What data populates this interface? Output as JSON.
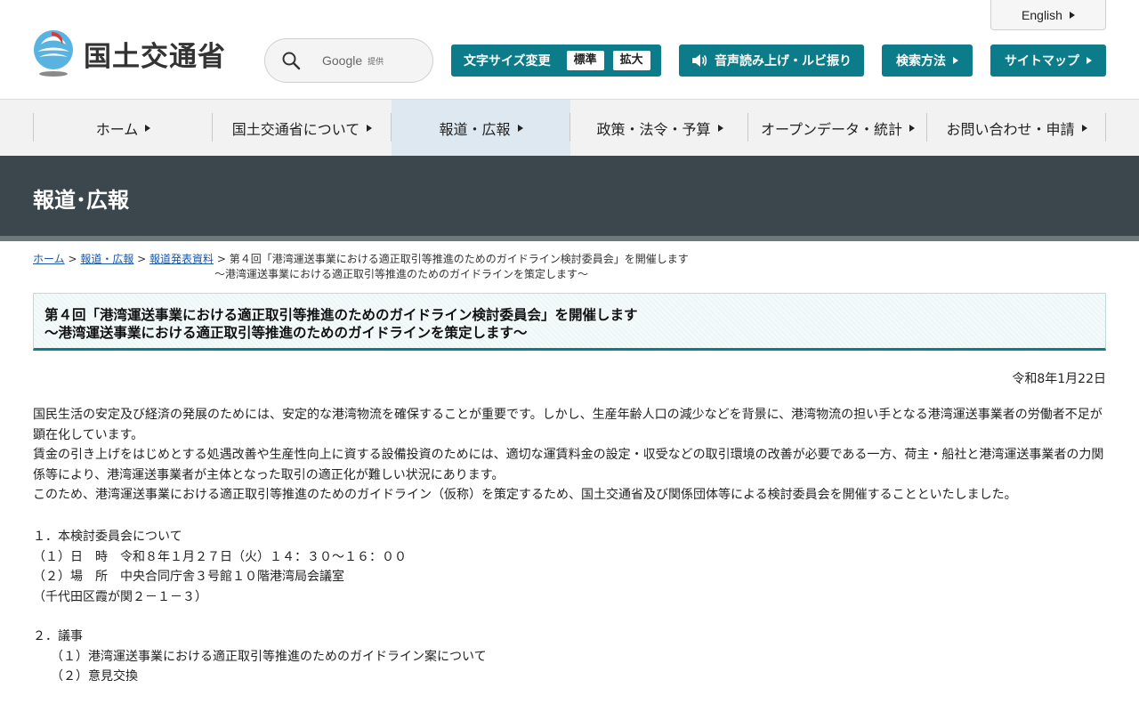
{
  "header": {
    "logo_text": "国土交通省",
    "search": {
      "label": "Google",
      "sublabel": "提供"
    },
    "english_label": "English",
    "font_size": {
      "label": "文字サイズ変更",
      "standard": "標準",
      "large": "拡大"
    },
    "voice_label": "音声読み上げ・ルビ振り",
    "search_method_label": "検索方法",
    "sitemap_label": "サイトマップ"
  },
  "nav": {
    "items": [
      {
        "label": "ホーム"
      },
      {
        "label": "国土交通省について"
      },
      {
        "label": "報道・広報"
      },
      {
        "label": "政策・法令・予算"
      },
      {
        "label": "オープンデータ・統計"
      },
      {
        "label": "お問い合わせ・申請"
      }
    ]
  },
  "page_title": "報道･広報",
  "breadcrumb": {
    "home": "ホーム",
    "sep1": " > ",
    "press": "報道・広報",
    "sep2": " > ",
    "releases": "報道発表資料",
    "current_line1": " > 第４回「港湾運送事業における適正取引等推進のためのガイドライン検討委員会」を開催します",
    "current_line2": "～港湾運送事業における適正取引等推進のためのガイドラインを策定します～"
  },
  "article": {
    "title_line1": "第４回「港湾運送事業における適正取引等推進のためのガイドライン検討委員会」を開催します",
    "title_line2": "～港湾運送事業における適正取引等推進のためのガイドラインを策定します～",
    "date": "令和8年1月22日",
    "paragraphs": [
      "国民生活の安定及び経済の発展のためには、安定的な港湾物流を確保することが重要です。しかし、生産年齢人口の減少などを背景に、港湾物流の担い手となる港湾運送事業者の労働者不足が顕在化しています。",
      "賃金の引き上げをはじめとする処遇改善や生産性向上に資する設備投資のためには、適切な運賃料金の設定・収受などの取引環境の改善が必要である一方、荷主・船社と港湾運送事業者の力関係等により、港湾運送事業者が主体となった取引の適正化が難しい状況にあります。",
      "このため、港湾運送事業における適正取引等推進のためのガイドライン（仮称）を策定するため、国土交通省及び関係団体等による検討委員会を開催することといたしました。"
    ],
    "section1": {
      "heading": "１．本検討委員会について",
      "datetime": "（１）日　時　令和８年１月２７日（火）１４：３０～１６：００",
      "place": "（２）場　所　中央合同庁舎３号館１０階港湾局会議室",
      "address": "（千代田区霞が関２－１－３）"
    },
    "section2": {
      "heading": "２．議事",
      "item1": "（１）港湾運送事業における適正取引等推進のためのガイドライン案について",
      "item2": "（２）意見交換"
    }
  },
  "colors": {
    "teal": "#0d7c8a",
    "band": "#3b474c",
    "link": "#1a57a8"
  }
}
